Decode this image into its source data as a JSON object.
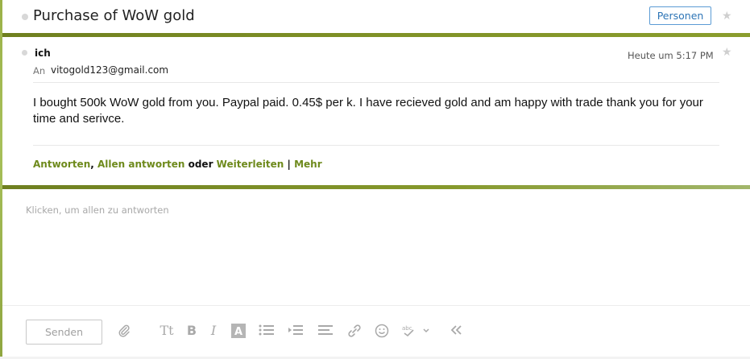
{
  "header": {
    "subject": "Purchase of WoW gold",
    "people_button": "Personen"
  },
  "message": {
    "sender": "ich",
    "to_label": "An",
    "to_address": "vitogold123@gmail.com",
    "timestamp": "Heute um 5:17 PM",
    "body": "I bought 500k WoW gold from you. Paypal paid. 0.45$ per k. I have recieved gold and am happy with trade thank you for your time and serivce.",
    "actions": {
      "reply": "Antworten",
      "comma": ",",
      "reply_all": "Allen antworten",
      "or": "oder",
      "forward": "Weiterleiten",
      "pipe": "|",
      "more": "Mehr"
    }
  },
  "reply": {
    "placeholder": "Klicken, um allen zu antworten",
    "send_button": "Senden"
  },
  "toolbar": {
    "icons": [
      "paperclip-icon",
      "font-size-icon",
      "bold-icon",
      "italic-icon",
      "text-color-icon",
      "bullet-list-icon",
      "indent-icon",
      "align-icon",
      "link-icon",
      "emoji-icon",
      "spellcheck-icon",
      "collapse-icon"
    ]
  },
  "colors": {
    "accent_green": "#6e8a1c",
    "bar_green": "#7f9126",
    "button_blue": "#2e75b6"
  }
}
